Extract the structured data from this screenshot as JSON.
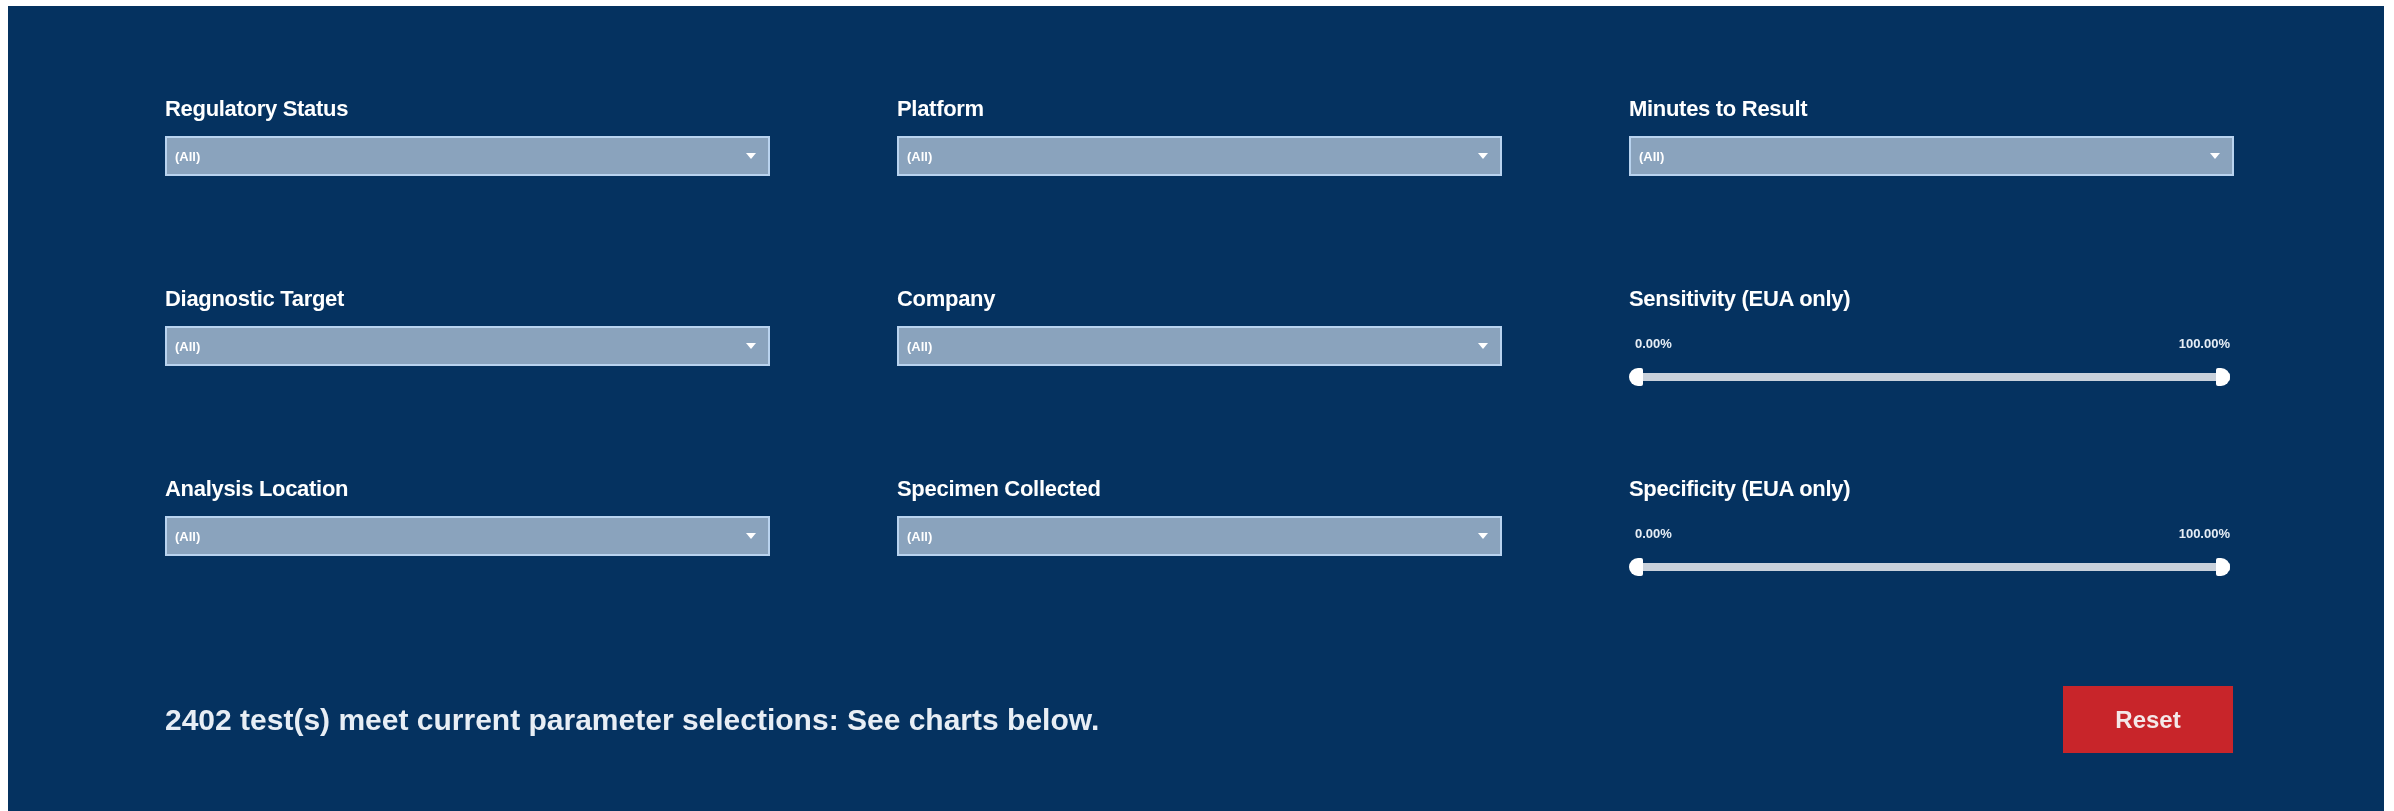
{
  "filters": [
    {
      "kind": "dropdown",
      "label": "Regulatory Status",
      "value": "(All)"
    },
    {
      "kind": "dropdown",
      "label": "Platform",
      "value": "(All)"
    },
    {
      "kind": "dropdown",
      "label": "Minutes to Result",
      "value": "(All)"
    },
    {
      "kind": "dropdown",
      "label": "Diagnostic Target",
      "value": "(All)"
    },
    {
      "kind": "dropdown",
      "label": "Company",
      "value": "(All)"
    },
    {
      "kind": "range",
      "label": "Sensitivity (EUA only)",
      "min_reading": "0.00%",
      "max_reading": "100.00%",
      "level": 1
    },
    {
      "kind": "dropdown",
      "label": "Analysis Location",
      "value": "(All)"
    },
    {
      "kind": "dropdown",
      "label": "Specimen Collected",
      "value": "(All)"
    },
    {
      "kind": "range",
      "label": "Specificity (EUA only)",
      "min_reading": "0.00%",
      "max_reading": "100.00%",
      "level": 1
    }
  ],
  "summary": "2402 test(s) meet current parameter selections: See charts below.",
  "reset_button": "Reset"
}
